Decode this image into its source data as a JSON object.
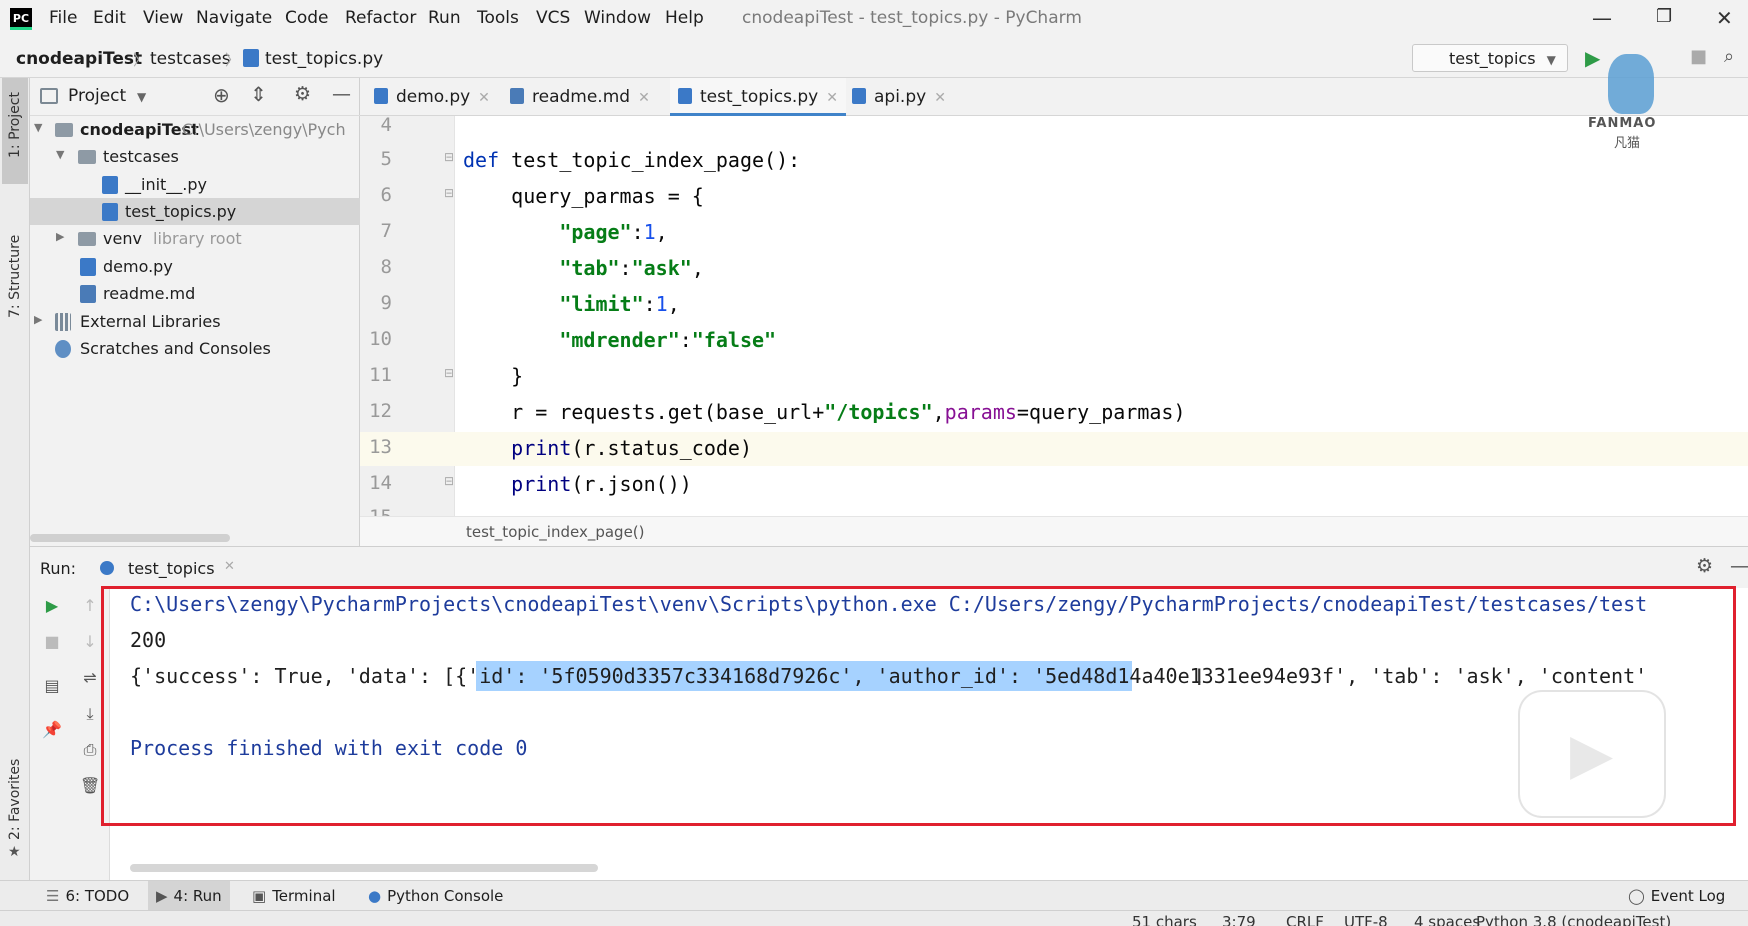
{
  "app": {
    "window_title": "cnodeapiTest - test_topics.py - PyCharm",
    "menu": [
      "File",
      "Edit",
      "View",
      "Navigate",
      "Code",
      "Refactor",
      "Run",
      "Tools",
      "VCS",
      "Window",
      "Help"
    ]
  },
  "breadcrumb": [
    "cnodeapiTest",
    "testcases",
    "test_topics.py"
  ],
  "run_config": "test_topics",
  "left_strip": {
    "project": "1: Project",
    "structure": "7: Structure",
    "favorites": "2: Favorites"
  },
  "project_panel": {
    "title": "Project",
    "tree": [
      {
        "label": "cnodeapiTest",
        "hint": "C:\\Users\\zengy\\Pych",
        "level": 0,
        "type": "folder",
        "expanded": true
      },
      {
        "label": "testcases",
        "level": 1,
        "type": "folder",
        "expanded": true
      },
      {
        "label": "__init__.py",
        "level": 2,
        "type": "py"
      },
      {
        "label": "test_topics.py",
        "level": 2,
        "type": "py",
        "selected": true
      },
      {
        "label": "venv",
        "hint": "library root",
        "level": 1,
        "type": "folder",
        "expanded": false
      },
      {
        "label": "demo.py",
        "level": 1,
        "type": "py"
      },
      {
        "label": "readme.md",
        "level": 1,
        "type": "md"
      },
      {
        "label": "External Libraries",
        "level": 0,
        "type": "lib",
        "expanded": false
      },
      {
        "label": "Scratches and Consoles",
        "level": 0,
        "type": "scratch"
      }
    ]
  },
  "editor": {
    "tabs": [
      {
        "label": "demo.py",
        "type": "py",
        "active": false
      },
      {
        "label": "readme.md",
        "type": "md",
        "active": false
      },
      {
        "label": "test_topics.py",
        "type": "py",
        "active": true
      },
      {
        "label": "api.py",
        "type": "py",
        "active": false
      }
    ],
    "line_numbers": [
      "4",
      "5",
      "6",
      "7",
      "8",
      "9",
      "10",
      "11",
      "12",
      "13",
      "14",
      "15"
    ],
    "current_line": "13",
    "function_breadcrumb": "test_topic_index_page()",
    "code": {
      "l5_def": "def",
      "l5_name": " test_topic_index_page():",
      "l6": "    query_parmas = {",
      "l7_key": "        \"page\"",
      "l7_sep": ":",
      "l7_val": "1",
      "l7_end": ",",
      "l8_key": "        \"tab\"",
      "l8_sep": ":",
      "l8_val": "\"ask\"",
      "l8_end": ",",
      "l9_key": "        \"limit\"",
      "l9_sep": ":",
      "l9_val": "1",
      "l9_end": ",",
      "l10_key": "        \"mdrender\"",
      "l10_sep": ":",
      "l10_val": "\"false\"",
      "l11": "    }",
      "l12_a": "    r = requests.get(base_url+",
      "l12_str": "\"/topics\"",
      "l12_b": ",",
      "l12_param": "params",
      "l12_c": "=query_parmas)",
      "l13_print": "    print",
      "l13_rest": "(r.status_code)",
      "l14_print": "    print",
      "l14_rest": "(r.json())"
    }
  },
  "run_panel": {
    "label": "Run:",
    "tab": "test_topics",
    "console": {
      "line1": "C:\\Users\\zengy\\PycharmProjects\\cnodeapiTest\\venv\\Scripts\\python.exe C:/Users/zengy/PycharmProjects/cnodeapiTest/testcases/test",
      "line2": "200",
      "line3": "{'success': True, 'data': [{'id': '5f0590d3357c334168d7926c', 'author_id': '5ed48d14a40e1331ee94e93f', 'tab': 'ask', 'content'",
      "line5": "Process finished with exit code 0"
    }
  },
  "bottom_tabs": {
    "todo": "6: TODO",
    "run": "4: Run",
    "terminal": "Terminal",
    "python_console": "Python Console",
    "event_log": "Event Log"
  },
  "status": {
    "chars": "51 chars",
    "position": "3:79",
    "line_sep": "CRLF",
    "encoding": "UTF-8",
    "indent": "4 spaces",
    "interpreter": "Python 3.8 (cnodeapiTest)"
  },
  "logo": {
    "brand": "FANMAO",
    "brand_cn": "凡猫"
  },
  "colors": {
    "highlight_border": "#e0202e",
    "selection": "#a6d2ff",
    "keyword": "#0033b3",
    "string": "#067d17"
  }
}
